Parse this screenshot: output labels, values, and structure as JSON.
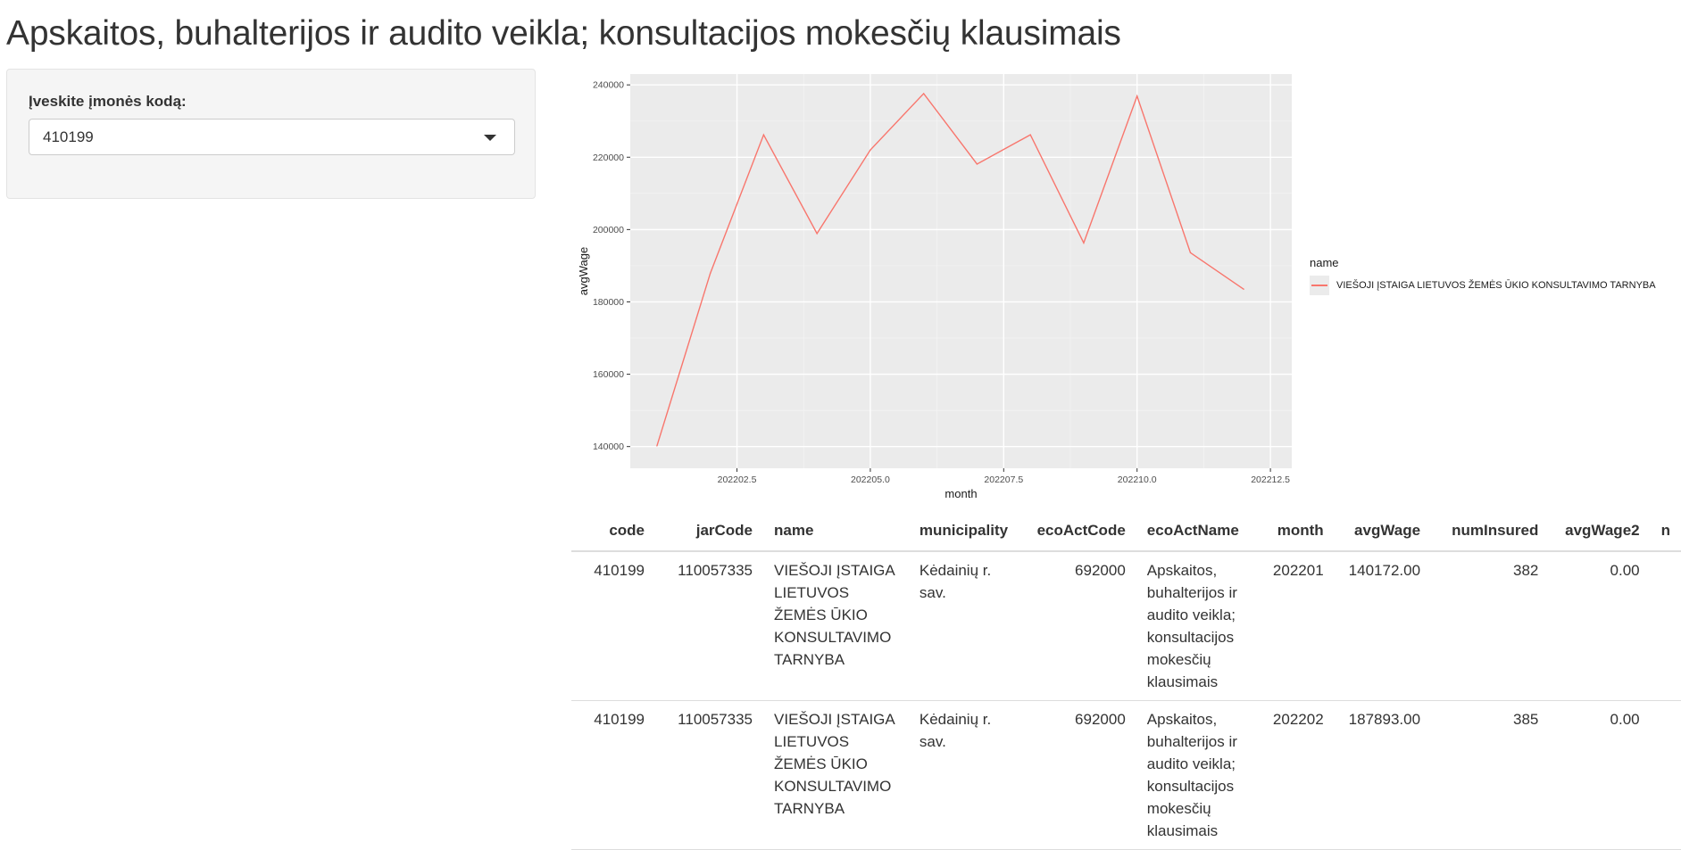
{
  "header": {
    "title": "Apskaitos, buhalterijos ir audito veikla; konsultacijos mokesčių klausimais"
  },
  "sidebar": {
    "label": "Įveskite įmonės kodą:",
    "select_value": "410199"
  },
  "chart_data": {
    "type": "line",
    "xlabel": "month",
    "ylabel": "avgWage",
    "x_tick_labels": [
      "202202.5",
      "202205.0",
      "202207.5",
      "202210.0",
      "202212.5"
    ],
    "y_tick_labels": [
      "140000",
      "160000",
      "180000",
      "200000",
      "220000",
      "240000"
    ],
    "legend": {
      "title": "name",
      "position": "right"
    },
    "series": [
      {
        "name": "VIEŠOJI ĮSTAIGA LIETUVOS ŽEMĖS ŪKIO KONSULTAVIMO TARNYBA",
        "color": "#F8766D",
        "x": [
          202201,
          202202,
          202203,
          202204,
          202205,
          202206,
          202207,
          202208,
          202209,
          202210,
          202211,
          202212
        ],
        "values": [
          140172,
          187893,
          226200,
          198900,
          222000,
          237600,
          218100,
          226200,
          196300,
          236900,
          193600,
          183500
        ]
      }
    ],
    "grid": true,
    "background": "#EBEBEB"
  },
  "table": {
    "columns": [
      "code",
      "jarCode",
      "name",
      "municipality",
      "ecoActCode",
      "ecoActName",
      "month",
      "avgWage",
      "numInsured",
      "avgWage2",
      "n"
    ],
    "rows": [
      [
        "410199",
        "110057335",
        "VIEŠOJI ĮSTAIGA LIETUVOS ŽEMĖS ŪKIO KONSULTAVIMO TARNYBA",
        "Kėdainių r. sav.",
        "692000",
        "Apskaitos, buhalterijos ir audito veikla; konsultacijos mokesčių klausimais",
        "202201",
        "140172.00",
        "382",
        "0.00",
        ""
      ],
      [
        "410199",
        "110057335",
        "VIEŠOJI ĮSTAIGA LIETUVOS ŽEMĖS ŪKIO KONSULTAVIMO TARNYBA",
        "Kėdainių r. sav.",
        "692000",
        "Apskaitos, buhalterijos ir audito veikla; konsultacijos mokesčių klausimais",
        "202202",
        "187893.00",
        "385",
        "0.00",
        ""
      ]
    ]
  }
}
